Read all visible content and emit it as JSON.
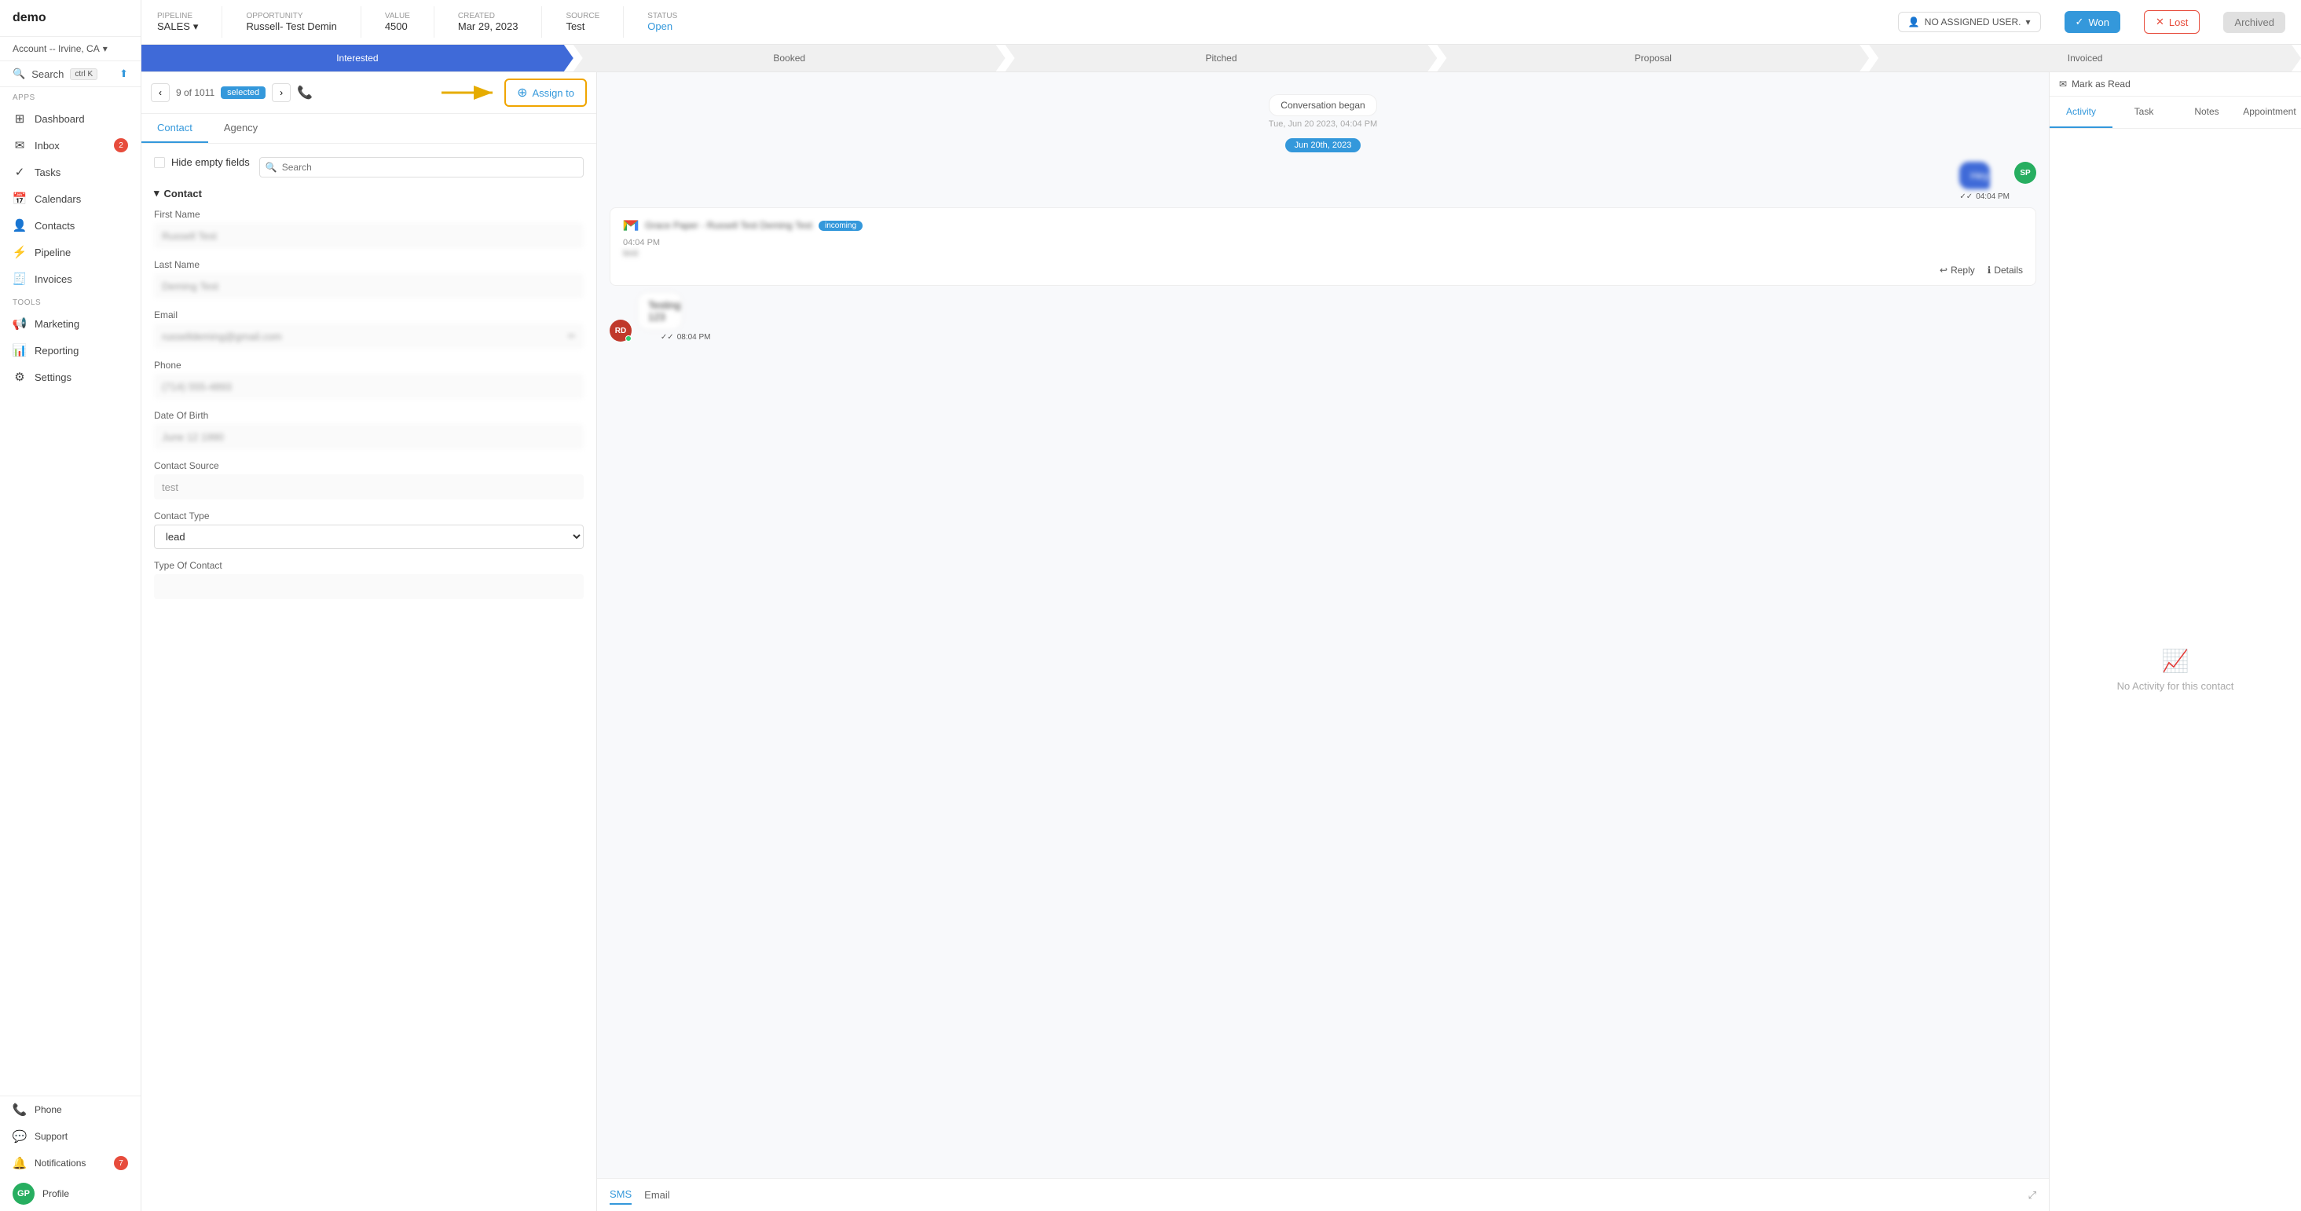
{
  "app": {
    "logo": "demo",
    "hamburger": "☰"
  },
  "account": {
    "label": "Account -- Irvine, CA",
    "chevron": "▾"
  },
  "sidebar": {
    "search_label": "Search",
    "search_kbd": "ctrl K",
    "apps_section": "Apps",
    "tools_section": "Tools",
    "nav_items": [
      {
        "id": "dashboard",
        "icon": "⊞",
        "label": "Dashboard"
      },
      {
        "id": "inbox",
        "icon": "✉",
        "label": "Inbox",
        "badge": "2"
      },
      {
        "id": "tasks",
        "icon": "✓",
        "label": "Tasks"
      },
      {
        "id": "calendars",
        "icon": "📅",
        "label": "Calendars"
      },
      {
        "id": "contacts",
        "icon": "👤",
        "label": "Contacts"
      },
      {
        "id": "pipeline",
        "icon": "⚡",
        "label": "Pipeline"
      },
      {
        "id": "invoices",
        "icon": "🧾",
        "label": "Invoices"
      }
    ],
    "tools_items": [
      {
        "id": "marketing",
        "icon": "📢",
        "label": "Marketing"
      },
      {
        "id": "reporting",
        "icon": "📊",
        "label": "Reporting"
      },
      {
        "id": "settings",
        "icon": "⚙",
        "label": "Settings"
      }
    ],
    "bottom_items": [
      {
        "id": "phone",
        "icon": "📞",
        "label": "Phone"
      },
      {
        "id": "support",
        "icon": "💬",
        "label": "Support"
      },
      {
        "id": "notifications",
        "icon": "🔔",
        "label": "Notifications",
        "badge": "7"
      },
      {
        "id": "profile",
        "label": "Profile",
        "initials": "GP"
      }
    ]
  },
  "header": {
    "pipeline_label": "Pipeline",
    "pipeline_value": "SALES",
    "opportunity_label": "Opportunity",
    "opportunity_value": "Russell- Test Demin",
    "value_label": "Value",
    "value_value": "4500",
    "created_label": "Created",
    "created_value": "Mar 29, 2023",
    "source_label": "Source",
    "source_value": "Test",
    "status_label": "Status",
    "status_value": "Open",
    "assign_label": "NO ASSIGNED USER.",
    "btn_won": "Won",
    "btn_lost": "Lost",
    "btn_archived": "Archived"
  },
  "stages": [
    {
      "id": "interested",
      "label": "Interested",
      "active": true
    },
    {
      "id": "booked",
      "label": "Booked",
      "active": false
    },
    {
      "id": "pitched",
      "label": "Pitched",
      "active": false
    },
    {
      "id": "proposal",
      "label": "Proposal",
      "active": false
    },
    {
      "id": "invoiced",
      "label": "Invoiced",
      "active": false
    }
  ],
  "contact_toolbar": {
    "prev": "‹",
    "next": "›",
    "counter_text": "9 of 1011",
    "selected_label": "selected",
    "assign_to_label": "Assign to",
    "phone_icon": "📞"
  },
  "contact_tabs": [
    {
      "id": "contact",
      "label": "Contact",
      "active": true
    },
    {
      "id": "agency",
      "label": "Agency",
      "active": false
    }
  ],
  "contact_fields_toolbar": {
    "hide_empty": "Hide empty fields",
    "search_placeholder": "Search"
  },
  "contact_section": {
    "label": "Contact",
    "chevron": "▾"
  },
  "fields": [
    {
      "label": "First Name",
      "value": "Russell Test",
      "blurred": true
    },
    {
      "label": "Last Name",
      "value": "Deming Test",
      "blurred": true
    },
    {
      "label": "Email",
      "value": "russelldeming@gmail.com",
      "blurred": true,
      "has_edit": true
    },
    {
      "label": "Phone",
      "value": "(714) 555-4893",
      "blurred": true
    },
    {
      "label": "Date Of Birth",
      "value": "June 12 1990",
      "blurred": true
    },
    {
      "label": "Contact Source",
      "value": "test",
      "blurred": false
    },
    {
      "label": "Contact Type",
      "value": "lead",
      "is_select": true
    },
    {
      "label": "Type Of Contact",
      "value": "",
      "blurred": false
    }
  ],
  "conversation": {
    "system_msg": "Conversation began",
    "system_time": "Tue, Jun 20 2023, 04:04 PM",
    "date_divider": "Jun 20th, 2023",
    "outgoing_time": "04:04 PM",
    "email_subject": "Grace Paper - Russell Test Deming Test",
    "email_time": "04:04 PM",
    "email_body": "test",
    "email_label": "incoming",
    "reply_btn": "Reply",
    "details_btn": "Details",
    "incoming_msg": "Testing 123",
    "incoming_time": "08:04 PM",
    "footer_sms": "SMS",
    "footer_email": "Email",
    "no_activity": "No Activity for this contact"
  },
  "activity_tabs": [
    {
      "id": "activity",
      "label": "Activity",
      "active": true
    },
    {
      "id": "task",
      "label": "Task",
      "active": false
    },
    {
      "id": "notes",
      "label": "Notes",
      "active": false
    },
    {
      "id": "appointment",
      "label": "Appointment",
      "active": false
    }
  ],
  "mark_read": {
    "icon": "✉",
    "label": "Mark as Read"
  }
}
